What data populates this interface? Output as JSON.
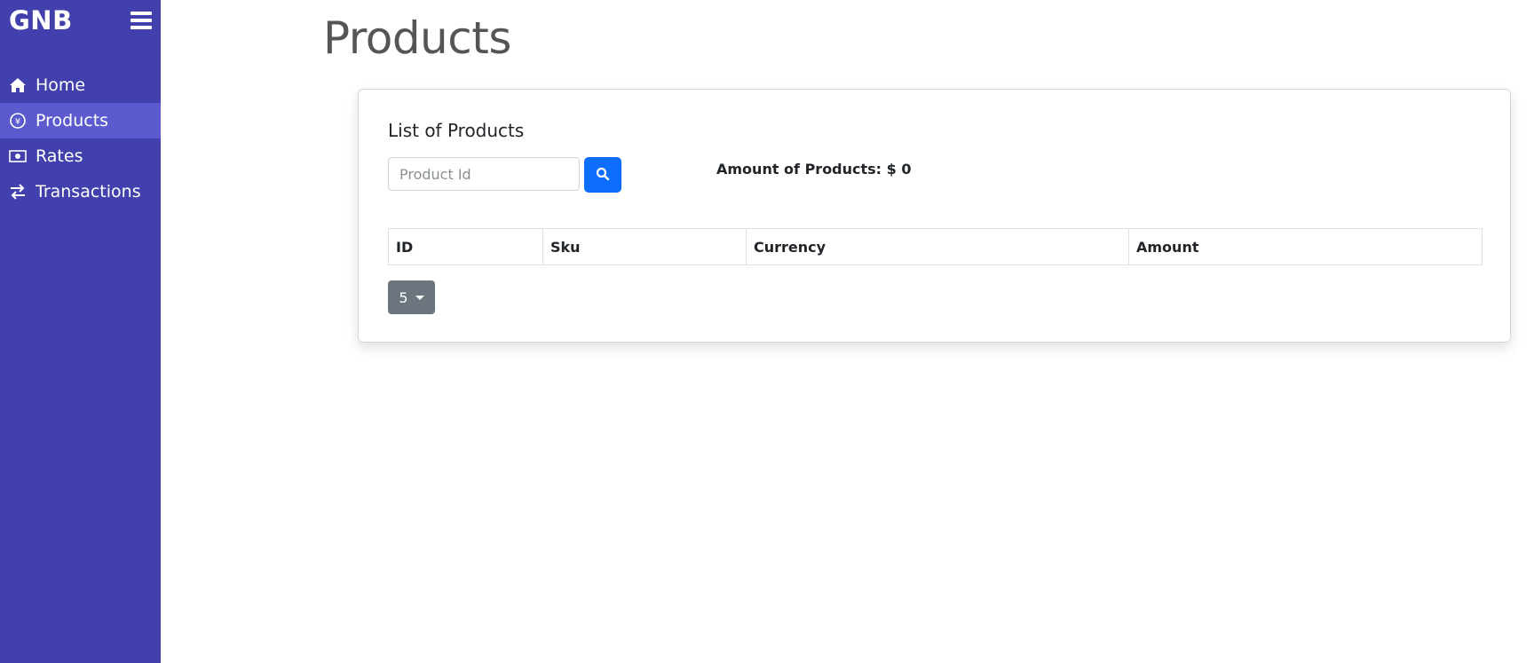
{
  "sidebar": {
    "brand": "GNB",
    "items": [
      {
        "label": "Home",
        "icon": "home-icon",
        "active": false
      },
      {
        "label": "Products",
        "icon": "currency-exchange-icon",
        "active": true
      },
      {
        "label": "Rates",
        "icon": "banknote-icon",
        "active": false
      },
      {
        "label": "Transactions",
        "icon": "arrows-exchange-icon",
        "active": false
      }
    ]
  },
  "page": {
    "title": "Products"
  },
  "card": {
    "title": "List of Products",
    "search": {
      "placeholder": "Product Id",
      "value": ""
    },
    "amount_label": "Amount of Products: $ 0",
    "table": {
      "columns": [
        "ID",
        "Sku",
        "Currency",
        "Amount"
      ],
      "rows": []
    },
    "page_size": "5"
  },
  "colors": {
    "sidebar_bg": "#4140ad",
    "sidebar_active": "#5b5bcf",
    "primary": "#0d6efd",
    "secondary": "#6c757d"
  }
}
